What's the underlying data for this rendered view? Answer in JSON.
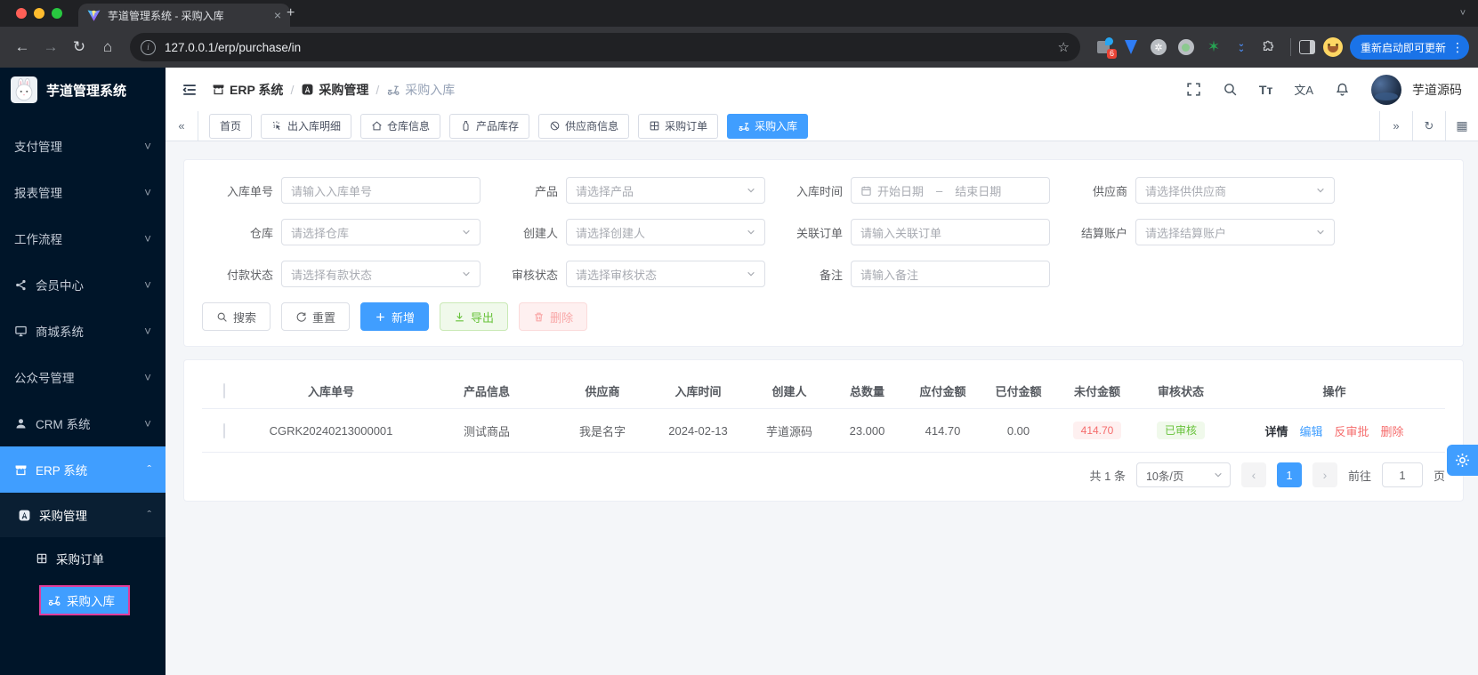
{
  "browser": {
    "tab_title": "芋道管理系统 - 采购入库",
    "close_glyph": "×",
    "new_tab_glyph": "+",
    "url": "127.0.0.1/erp/purchase/in",
    "info_glyph": "i",
    "star_glyph": "☆",
    "back_glyph": "←",
    "forward_glyph": "→",
    "reload_glyph": "↻",
    "home_glyph": "⌂",
    "ext_badge": "6",
    "ext_star_glyph": "✶",
    "update_button": "重新启动即可更新",
    "kebab_glyph": "⋮",
    "tabsearch_glyph": "˅"
  },
  "sidebar": {
    "logo_title": "芋道管理系统",
    "chev_down": "˅",
    "chev_up": "ˆ",
    "items": [
      {
        "label": "支付管理"
      },
      {
        "label": "报表管理"
      },
      {
        "label": "工作流程"
      },
      {
        "label": "会员中心"
      },
      {
        "label": "商城系统"
      },
      {
        "label": "公众号管理"
      },
      {
        "label": "CRM 系统"
      },
      {
        "label": "ERP 系统"
      },
      {
        "label": "采购管理"
      },
      {
        "label": "采购订单"
      },
      {
        "label": "采购入库"
      }
    ]
  },
  "header": {
    "separator": "/",
    "breadcrumb": [
      {
        "label": "ERP 系统"
      },
      {
        "label": "采购管理"
      },
      {
        "label": "采购入库"
      }
    ],
    "font_icon": "Tт",
    "lang_icon": "文A",
    "username": "芋道源码"
  },
  "views": {
    "left_arrow": "«",
    "right_arrow": "»",
    "refresh_glyph": "↻",
    "grid_glyph": "▦",
    "tabs": [
      {
        "label": "首页"
      },
      {
        "label": "出入库明细"
      },
      {
        "label": "仓库信息"
      },
      {
        "label": "产品库存"
      },
      {
        "label": "供应商信息"
      },
      {
        "label": "采购订单"
      },
      {
        "label": "采购入库"
      }
    ]
  },
  "filters": {
    "fields": [
      {
        "label": "入库单号",
        "placeholder": "请输入入库单号"
      },
      {
        "label": "产品",
        "placeholder": "请选择产品"
      },
      {
        "label": "入库时间",
        "start": "开始日期",
        "sep": "–",
        "end": "结束日期"
      },
      {
        "label": "供应商",
        "placeholder": "请选择供供应商"
      },
      {
        "label": "仓库",
        "placeholder": "请选择仓库"
      },
      {
        "label": "创建人",
        "placeholder": "请选择创建人"
      },
      {
        "label": "关联订单",
        "placeholder": "请输入关联订单"
      },
      {
        "label": "结算账户",
        "placeholder": "请选择结算账户"
      },
      {
        "label": "付款状态",
        "placeholder": "请选择有款状态"
      },
      {
        "label": "审核状态",
        "placeholder": "请选择审核状态"
      },
      {
        "label": "备注",
        "placeholder": "请输入备注"
      }
    ],
    "buttons": {
      "search": "搜索",
      "reset": "重置",
      "add": "新增",
      "export": "导出",
      "delete": "删除"
    }
  },
  "table": {
    "columns": [
      "入库单号",
      "产品信息",
      "供应商",
      "入库时间",
      "创建人",
      "总数量",
      "应付金额",
      "已付金额",
      "未付金额",
      "审核状态",
      "操作"
    ],
    "row": {
      "no": "CGRK20240213000001",
      "product": "测试商品",
      "supplier": "我是名字",
      "date": "2024-02-13",
      "creator": "芋道源码",
      "qty": "23.000",
      "payable": "414.70",
      "paid": "0.00",
      "unpaid": "414.70",
      "status": "已审核",
      "actions": [
        "详情",
        "编辑",
        "反审批",
        "删除"
      ]
    }
  },
  "pagination": {
    "total": "共 1 条",
    "page_size": "10条/页",
    "prev": "‹",
    "page": "1",
    "next": "›",
    "goto": "前往",
    "goto_value": "1",
    "unit": "页"
  },
  "colors": {
    "primary": "#409eff",
    "success": "#67c23a",
    "danger": "#f56c6c",
    "sidebar_bg": "#001529",
    "highlight_border": "#e23c9b",
    "update_button_bg": "#1a73e8"
  }
}
